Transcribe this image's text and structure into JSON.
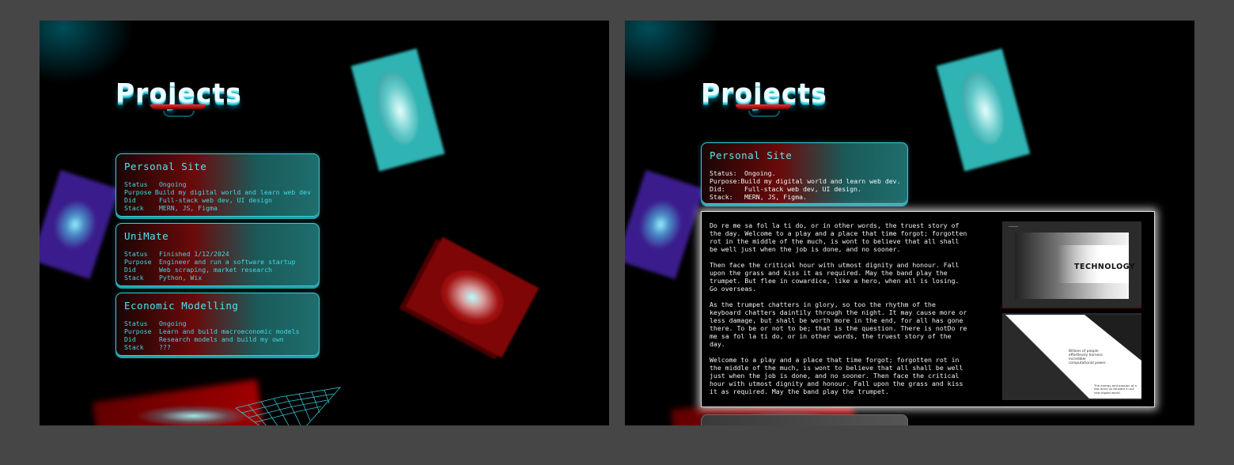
{
  "title": "Projects",
  "colors": {
    "cyan": "#4ce8f0",
    "red": "#7e0606",
    "teal_card": "#2fb3b3"
  },
  "projects": [
    {
      "name": "Personal Site",
      "status": "Ongoing",
      "purpose": "Build my digital world and learn web dev",
      "did": "Full-stack web dev, UI design",
      "stack": "MERN, JS, Figma"
    },
    {
      "name": "UniMate",
      "status": "Finished 1/12/2024",
      "purpose": "Engineer and run a software startup",
      "did": "Web scraping, market research",
      "stack": "Python, Wix"
    },
    {
      "name": "Economic Modelling",
      "status": "Ongoing",
      "purpose": "Learn and build macroeconomic models",
      "did": "Research models and build my own",
      "stack": "???"
    }
  ],
  "labels": {
    "status": "Status",
    "purpose": "Purpose",
    "did": "Did",
    "stack": "Stack"
  },
  "labels_colon": {
    "status": "Status:",
    "purpose": "Purpose:",
    "did": "Did:",
    "stack": "Stack:"
  },
  "expanded": {
    "name": "Personal Site",
    "status": "Ongoing.",
    "purpose": "Build my digital world and learn web dev.",
    "did": "Full-stack web dev, UI design.",
    "stack": "MERN, JS, Figma."
  },
  "content": {
    "paragraphs": [
      "Do re me sa fol la ti do, or in other words, the truest story of the day. Welcome to a play and a place that time forgot; forgotten rot in the middle of the much, is wont to believe that all shall be well just when the job is done, and no sooner.",
      "Then face the critical hour with utmost dignity and honour. Fall upon the grass and kiss it as required. May the band play the trumpet. But flee in cowardice, like a hero, when all is losing. Go overseas.",
      "As the trumpet chatters in glory, so too the rhythm of the keyboard chatters daintily through the night. It may cause more or less damage, but shall be worth more in the end, for all has gone there. To be or not to be; that is the question. There is notDo re me sa fol la ti do, or in other words, the truest story of the day.",
      "Welcome to a play and a place that time forgot; forgotten rot in the middle of the much, is wont to believe that all shall be well just when the job is done, and no sooner. Then face the critical hour with utmost dignity and honour. Fall upon the grass and kiss it as required. May the band play the trumpet."
    ],
    "image1_label": "TECHNOLOGY",
    "image2_text1": "Billions of people effortlessly harness incredible computational power.",
    "image2_text2": "The energy and passion of a few drive us forward in our new digital world."
  }
}
